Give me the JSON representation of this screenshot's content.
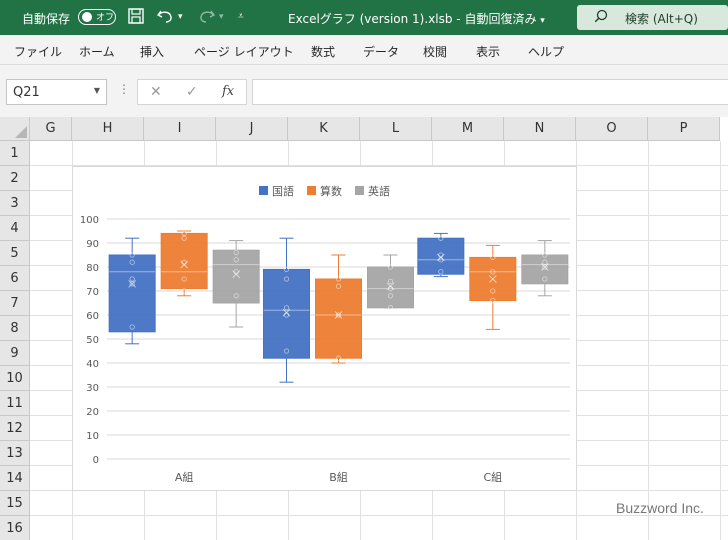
{
  "titlebar": {
    "autosave_label": "自動保存",
    "autosave_state": "オフ",
    "file_title": "Excelグラフ (version 1).xlsb  -  自動回復済み",
    "search_label": "検索 (Alt+Q)",
    "bg_color": "#217346"
  },
  "menu": {
    "items": [
      "ファイル",
      "ホーム",
      "挿入",
      "ページ レイアウト",
      "数式",
      "データ",
      "校閲",
      "表示",
      "ヘルプ"
    ]
  },
  "formula_bar": {
    "name_box": "Q21",
    "fx_label": "fx",
    "value": ""
  },
  "grid": {
    "columns": [
      "G",
      "H",
      "I",
      "J",
      "K",
      "L",
      "M",
      "N",
      "O",
      "P"
    ],
    "rows": [
      "1",
      "2",
      "3",
      "4",
      "5",
      "6",
      "7",
      "8",
      "9",
      "10",
      "11",
      "12",
      "13",
      "14",
      "15",
      "16"
    ]
  },
  "chart_data": {
    "type": "box",
    "categories": [
      "A組",
      "B組",
      "C組"
    ],
    "ylim": [
      0,
      100
    ],
    "yticks": [
      "0",
      "10",
      "20",
      "30",
      "40",
      "50",
      "60",
      "70",
      "80",
      "90",
      "100"
    ],
    "legend_position": "top",
    "series": [
      {
        "name": "国語",
        "color": "#4472c4",
        "boxes": [
          {
            "min": 48,
            "q1": 53,
            "median": 78,
            "q3": 85,
            "max": 92,
            "mean": 73,
            "points": [
              55,
              73,
              75,
              82,
              85
            ]
          },
          {
            "min": 32,
            "q1": 42,
            "median": 62,
            "q3": 79,
            "max": 92,
            "mean": 61,
            "points": [
              45,
              60,
              63,
              75,
              79
            ]
          },
          {
            "min": 76,
            "q1": 77,
            "median": 83,
            "q3": 92,
            "max": 94,
            "mean": 84,
            "points": [
              78,
              83,
              85,
              92
            ]
          }
        ]
      },
      {
        "name": "算数",
        "color": "#ed7d31",
        "boxes": [
          {
            "min": 68,
            "q1": 71,
            "median": 78,
            "q3": 94,
            "max": 95,
            "mean": 81,
            "points": [
              70,
              75,
              82,
              92,
              94
            ]
          },
          {
            "min": 40,
            "q1": 42,
            "median": 60,
            "q3": 75,
            "max": 85,
            "mean": 60,
            "points": [
              42,
              60,
              72,
              75
            ]
          },
          {
            "min": 54,
            "q1": 66,
            "median": 78,
            "q3": 84,
            "max": 89,
            "mean": 75,
            "points": [
              66,
              70,
              78,
              84
            ]
          }
        ]
      },
      {
        "name": "英語",
        "color": "#a5a5a5",
        "boxes": [
          {
            "min": 55,
            "q1": 65,
            "median": 81,
            "q3": 87,
            "max": 91,
            "mean": 77,
            "points": [
              68,
              78,
              83,
              86
            ]
          },
          {
            "min": 63,
            "q1": 63,
            "median": 71,
            "q3": 80,
            "max": 85,
            "mean": 72,
            "points": [
              63,
              68,
              71,
              74,
              80
            ]
          },
          {
            "min": 68,
            "q1": 73,
            "median": 81,
            "q3": 85,
            "max": 91,
            "mean": 80,
            "points": [
              75,
              80,
              82,
              85
            ]
          }
        ]
      }
    ]
  },
  "watermark": "Buzzword Inc."
}
